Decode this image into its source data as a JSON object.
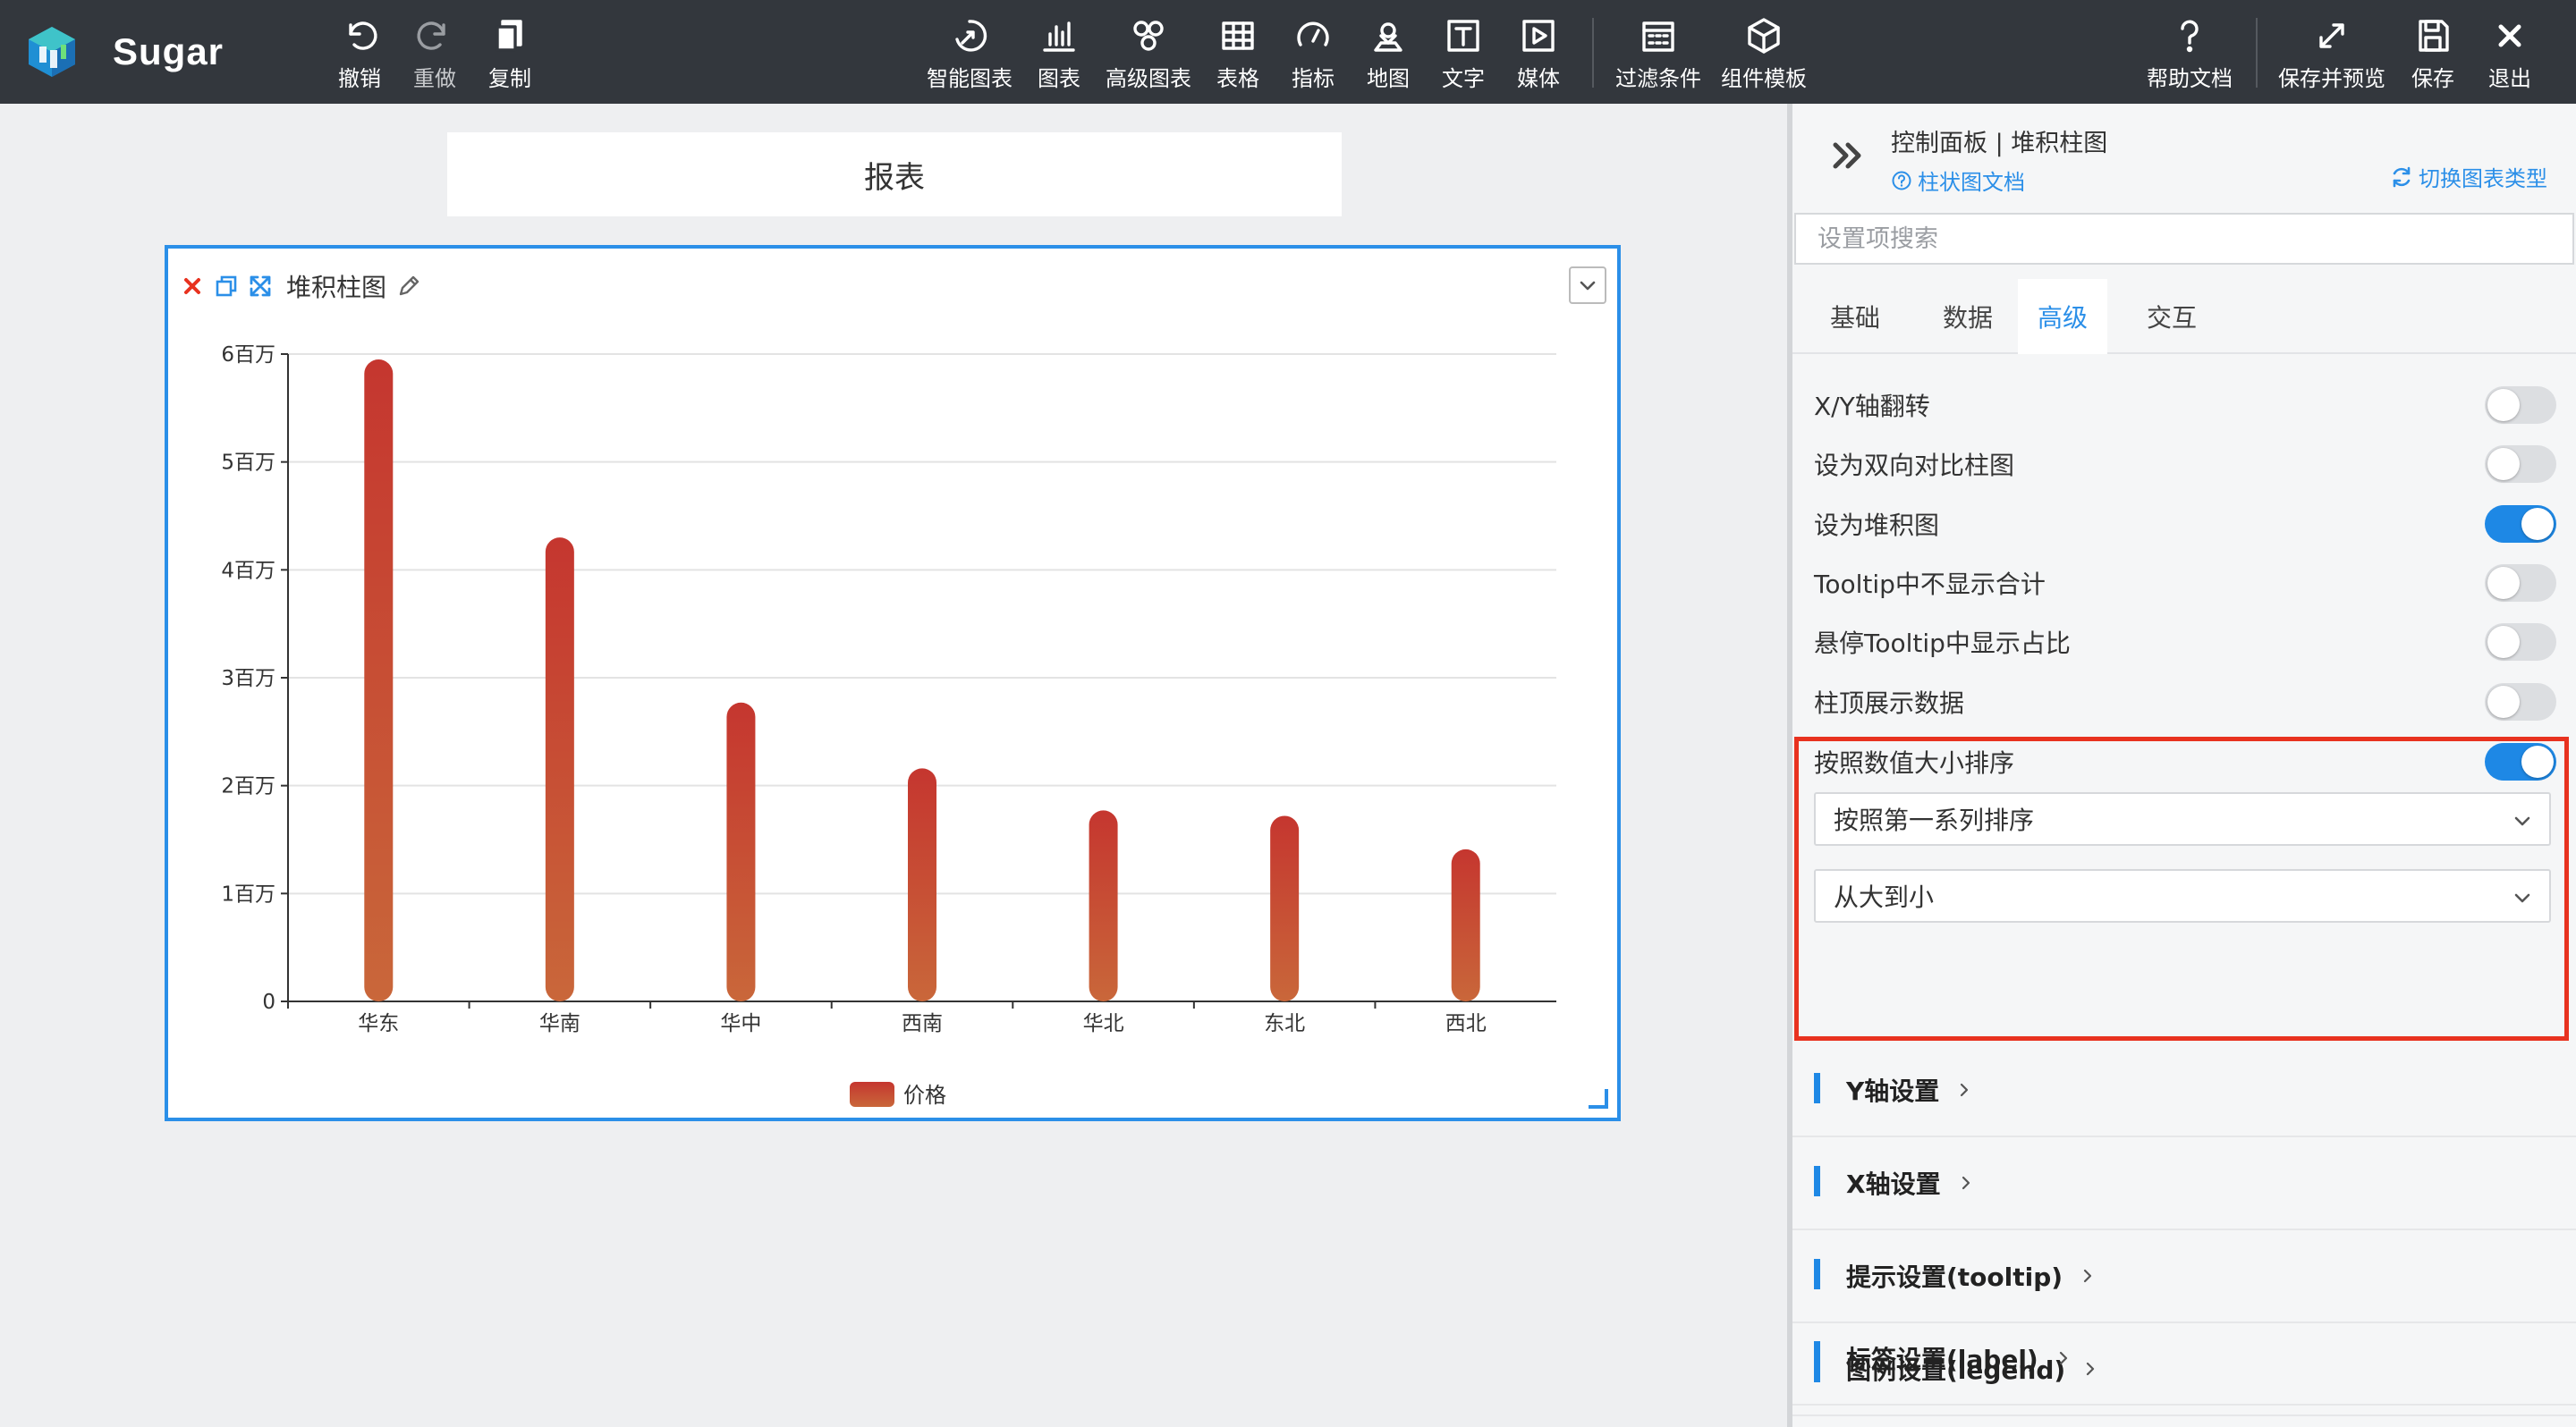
{
  "app": {
    "name": "Sugar"
  },
  "toolbar": {
    "undo": "撤销",
    "redo": "重做",
    "copy": "复制",
    "smart_chart": "智能图表",
    "chart": "图表",
    "advanced_chart": "高级图表",
    "table": "表格",
    "metric": "指标",
    "map": "地图",
    "text": "文字",
    "media": "媒体",
    "filter": "过滤条件",
    "component_template": "组件模板",
    "help": "帮助文档",
    "save_preview": "保存并预览",
    "save": "保存",
    "exit": "退出"
  },
  "report": {
    "title": "报表"
  },
  "chart_card": {
    "title": "堆积柱图"
  },
  "chart_data": {
    "type": "bar",
    "categories": [
      "华东",
      "华南",
      "华中",
      "西南",
      "华北",
      "东北",
      "西北"
    ],
    "series": [
      {
        "name": "价格",
        "values": [
          5950000,
          4300000,
          2770000,
          2160000,
          1770000,
          1720000,
          1410000
        ]
      }
    ],
    "y_ticks": [
      "0",
      "1百万",
      "2百万",
      "3百万",
      "4百万",
      "5百万",
      "6百万"
    ],
    "ylim": [
      0,
      6000000
    ],
    "grid": true,
    "legend_position": "bottom",
    "colors": {
      "bar_top": "#c5362f",
      "bar_bottom": "#c9673a"
    }
  },
  "panel": {
    "title": "控制面板 | 堆积柱图",
    "doc_link": "柱状图文档",
    "switch_link": "切换图表类型",
    "search_placeholder": "设置项搜索",
    "tabs": [
      {
        "label": "基础"
      },
      {
        "label": "数据"
      },
      {
        "label": "高级"
      },
      {
        "label": "交互"
      }
    ],
    "active_tab": "高级",
    "settings": [
      {
        "label": "X/Y轴翻转",
        "on": false
      },
      {
        "label": "设为双向对比柱图",
        "on": false
      },
      {
        "label": "设为堆积图",
        "on": true
      },
      {
        "label": "Tooltip中不显示合计",
        "on": false
      },
      {
        "label": "悬停Tooltip中显示占比",
        "on": false
      },
      {
        "label": "柱顶展示数据",
        "on": false
      },
      {
        "label": "按照数值大小排序",
        "on": true
      }
    ],
    "sort_series_select": "按照第一系列排序",
    "sort_order_select": "从大到小",
    "sections": [
      {
        "label": "Y轴设置"
      },
      {
        "label": "X轴设置"
      },
      {
        "label": "提示设置(tooltip)"
      },
      {
        "label": "图例设置(legend)"
      },
      {
        "label": "标签设置(label)"
      }
    ]
  },
  "colors": {
    "accent": "#1e88e5",
    "topbar": "#33373d",
    "highlight": "#e8321f"
  }
}
